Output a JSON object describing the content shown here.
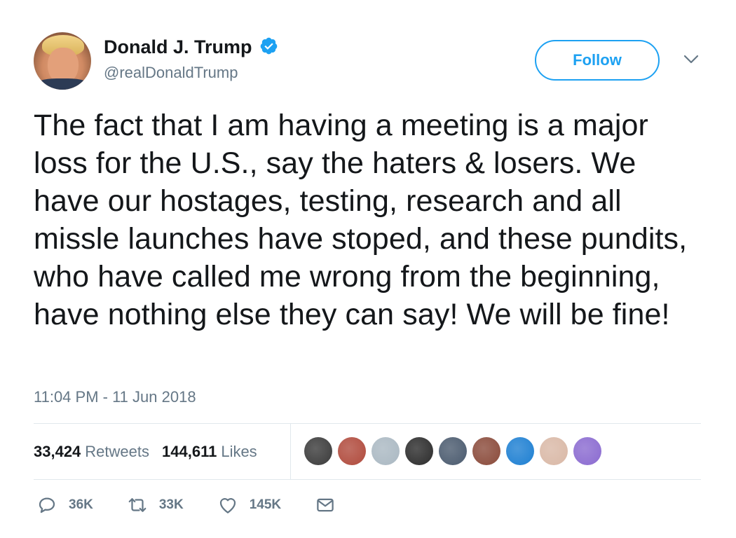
{
  "user": {
    "display_name": "Donald J. Trump",
    "handle": "@realDonaldTrump",
    "verified": true
  },
  "follow_button": {
    "label": "Follow"
  },
  "tweet": {
    "text": "The fact that I am having a meeting is a major loss for the U.S., say the haters & losers. We have our hostages, testing, research and all missle launches have stoped, and these pundits, who have called me wrong from the beginning, have nothing else they can say! We will be fine!",
    "timestamp": "11:04 PM - 11 Jun 2018"
  },
  "stats": {
    "retweets_count": "33,424",
    "retweets_label": "Retweets",
    "likes_count": "144,611",
    "likes_label": "Likes"
  },
  "likers": [
    {
      "color": "#3a3a3a"
    },
    {
      "color": "#b04a3c"
    },
    {
      "color": "#aab8c2"
    },
    {
      "color": "#2b2b2b"
    },
    {
      "color": "#4a5a6e"
    },
    {
      "color": "#8a4a3a"
    },
    {
      "color": "#1d7fd2"
    },
    {
      "color": "#d9b8a6"
    },
    {
      "color": "#8a6ad0"
    }
  ],
  "actions": {
    "reply_count": "36K",
    "retweet_count": "33K",
    "like_count": "145K"
  },
  "colors": {
    "accent": "#1da1f2",
    "secondary_text": "#657786",
    "divider": "#e1e8ed"
  }
}
